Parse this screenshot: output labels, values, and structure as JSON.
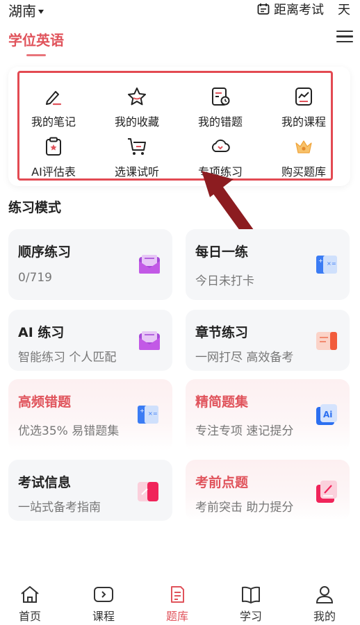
{
  "status": {
    "region": "湖南",
    "countdown_label": "距离考试",
    "countdown_unit": "天"
  },
  "header": {
    "title": "学位英语"
  },
  "quick_actions": [
    {
      "label": "我的笔记",
      "icon": "note-edit-icon"
    },
    {
      "label": "我的收藏",
      "icon": "star-icon"
    },
    {
      "label": "我的错题",
      "icon": "wrong-questions-icon"
    },
    {
      "label": "我的课程",
      "icon": "course-chart-icon"
    },
    {
      "label": "AI评估表",
      "icon": "clipboard-icon"
    },
    {
      "label": "选课试听",
      "icon": "cart-icon"
    },
    {
      "label": "专项练习",
      "icon": "cloud-download-icon"
    },
    {
      "label": "购买题库",
      "icon": "crown-icon"
    }
  ],
  "practice": {
    "section_title": "练习模式",
    "cards": [
      {
        "title": "顺序练习",
        "subtitle": "0/719",
        "icon": "envelope-icon"
      },
      {
        "title": "每日一练",
        "subtitle": "今日未打卡",
        "icon": "calculator-icon"
      },
      {
        "title": "AI 练习",
        "subtitle": "智能练习 个人匹配",
        "icon": "envelope-icon"
      },
      {
        "title": "章节练习",
        "subtitle": "一网打尽 高效备考",
        "icon": "book-chapters-icon"
      },
      {
        "title": "高频错题",
        "subtitle": "优选35% 易错题集",
        "icon": "calculator-icon"
      },
      {
        "title": "精简题集",
        "subtitle": "专注专项 速记提分",
        "icon": "ai-book-icon"
      },
      {
        "title": "考试信息",
        "subtitle": "一站式备考指南",
        "icon": "eraser-icon"
      },
      {
        "title": "考前点题",
        "subtitle": "考前突击 助力提分",
        "icon": "pen-note-icon"
      }
    ]
  },
  "tabbar": [
    {
      "label": "首页",
      "icon": "home-icon"
    },
    {
      "label": "课程",
      "icon": "play-icon"
    },
    {
      "label": "题库",
      "icon": "question-bank-icon"
    },
    {
      "label": "学习",
      "icon": "open-book-icon"
    },
    {
      "label": "我的",
      "icon": "user-icon"
    }
  ],
  "colors": {
    "accent": "#e0535b",
    "highlight_frame": "#e34a52",
    "arrow": "#8c1c20"
  }
}
